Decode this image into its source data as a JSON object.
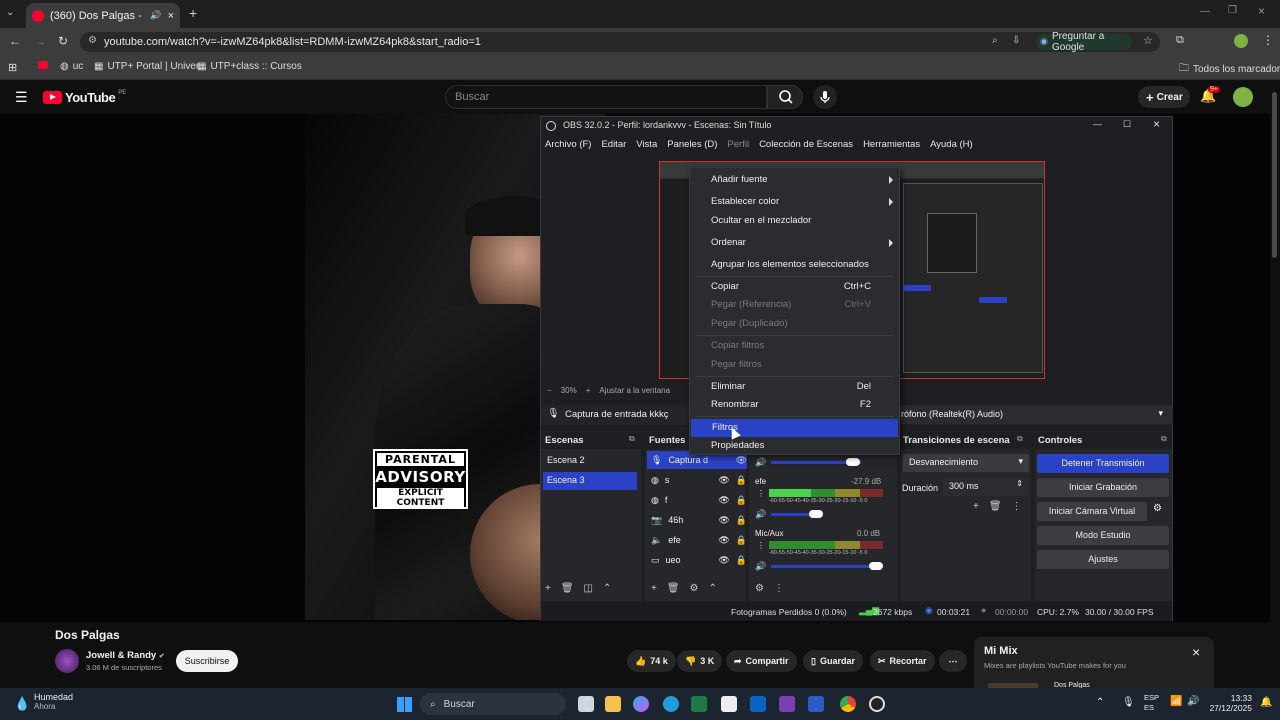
{
  "browser": {
    "tab_title": "(360) Dos Palgas - YouTube",
    "url": "youtube.com/watch?v=-izwMZ64pk8&list=RDMM-izwMZ64pk8&start_radio=1",
    "ask_google": "Preguntar a Google",
    "bookmarks": [
      "uc",
      "UTP+ Portal | Univer...",
      "UTP+class :: Cursos"
    ],
    "all_bookmarks": "Todos los marcadores"
  },
  "youtube": {
    "logo": "YouTube",
    "logo_country": "PE",
    "search_placeholder": "Buscar",
    "create_label": "Crear",
    "notif_count": "9+",
    "video_title": "Dos Palgas",
    "channel": "Jowell & Randy",
    "subscribers": "3.06 M de suscriptores",
    "subscribe": "Suscribirse",
    "likes": "74 k",
    "dislikes": "3 K",
    "share": "Compartir",
    "save": "Guardar",
    "clip": "Recortar",
    "mix_title": "Mi Mix",
    "mix_sub": "Mixes are playlists YouTube makes for you",
    "mix_item": "Dos Palgas"
  },
  "album": {
    "advisory_1": "PARENTAL",
    "advisory_2": "ADVISORY",
    "advisory_3": "EXPLICIT CONTENT"
  },
  "obs": {
    "title": "OBS 32.0.2 - Perfil: lordankvvv - Escenas: Sin Título",
    "menu": [
      "Archivo (F)",
      "Editar",
      "Vista",
      "Paneles (D)",
      "Perfil",
      "Colección de Escenas",
      "Herramientas",
      "Ayuda (H)"
    ],
    "zoom": "30%",
    "fit": "Ajustar a la ventana",
    "source_name": "Captura de entrada kkkç",
    "audio_device": "rófono (Realtek(R) Audio)",
    "docks": {
      "scenes": "Escenas",
      "sources": "Fuentes",
      "transitions": "Transiciones de escena",
      "controls": "Controles"
    },
    "scenes": [
      "Escena 2",
      "Escena 3"
    ],
    "sources": [
      "Captura d",
      "s",
      "f",
      "46h",
      "efe",
      "ueo"
    ],
    "mixer": [
      {
        "name": "efe",
        "db": "-27.9 dB"
      },
      {
        "name": "Mic/Aux",
        "db": "0.0 dB"
      }
    ],
    "meter_scale": "-60-55-50-45-40-35-30-25-20-15-10 -5 0",
    "transition": "Desvanecimiento",
    "duration_label": "Duración",
    "duration": "300 ms",
    "controls": [
      "Detener Transmisión",
      "Iniciar Grabación",
      "Iniciar Cámara Virtual",
      "Modo Estudio",
      "Ajustes"
    ],
    "status": {
      "dropped": "Fotogramas Perdidos 0 (0.0%)",
      "bitrate": "2672 kbps",
      "stream_time": "00:03:21",
      "rec_time": "00:00:00",
      "cpu": "CPU: 2.7%",
      "fps": "30.00 / 30.00 FPS"
    }
  },
  "context_menu": {
    "items": [
      {
        "label": "Añadir fuente",
        "submenu": true
      },
      {
        "label": "Establecer color",
        "submenu": true
      },
      {
        "label": "Ocultar en el mezclador"
      },
      {
        "label": "Ordenar",
        "submenu": true
      },
      {
        "label": "Agrupar los elementos seleccionados"
      },
      {
        "label": "Copiar",
        "shortcut": "Ctrl+C"
      },
      {
        "label": "Pegar (Referencia)",
        "shortcut": "Ctrl+V",
        "disabled": true
      },
      {
        "label": "Pegar (Duplicado)",
        "disabled": true
      },
      {
        "label": "Copiar filtros",
        "disabled": true
      },
      {
        "label": "Pegar filtros",
        "disabled": true
      },
      {
        "label": "Eliminar",
        "shortcut": "Del"
      },
      {
        "label": "Renombrar",
        "shortcut": "F2"
      },
      {
        "label": "Filtros",
        "selected": true
      },
      {
        "label": "Propiedades"
      }
    ]
  },
  "taskbar": {
    "weather_title": "Humedad",
    "weather_sub": "Ahora",
    "search": "Buscar",
    "lang_1": "ESP",
    "lang_2": "ES",
    "time": "13:33",
    "date": "27/12/2025"
  },
  "colors": {
    "accent": "#2a43c6",
    "yt_red": "#ff0033"
  }
}
